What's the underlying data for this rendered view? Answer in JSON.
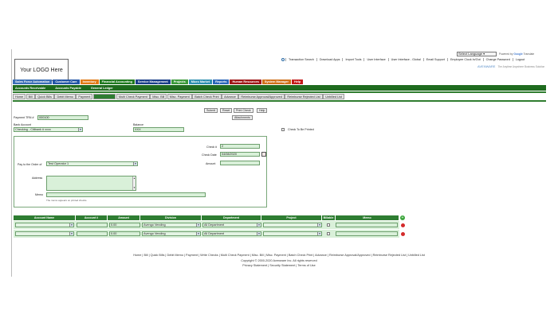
{
  "translate": {
    "select_label": "Select Language",
    "powered_by": "Powered by",
    "google": "Google",
    "translate_word": "Translate"
  },
  "logo_text": "Your LOGO Here",
  "top_links": [
    "Transaction Search",
    "Download Apps",
    "Import Tools",
    "User Interface",
    "User Interface - Global",
    "Email Support",
    "Employee Clock In/Out",
    "Change Password",
    "Logout"
  ],
  "brand": {
    "name": "AVENWARE",
    "tagline": "The Anytime Anywhere Business Solution"
  },
  "main_nav": [
    {
      "label": "Sales Force Automation",
      "color": "#3b6fb6"
    },
    {
      "label": "Customer Care",
      "color": "#2456a6"
    },
    {
      "label": "Inventory",
      "color": "#e07a16"
    },
    {
      "label": "Financial Accounting",
      "color": "#1f7a1f"
    },
    {
      "label": "Service Management",
      "color": "#1a3f8a"
    },
    {
      "label": "Projects",
      "color": "#3a9a3a"
    },
    {
      "label": "Micro Market",
      "color": "#2e8fb0"
    },
    {
      "label": "Reports",
      "color": "#2a66b8"
    },
    {
      "label": "Human Resources",
      "color": "#a01818"
    },
    {
      "label": "System Manager",
      "color": "#d0701a"
    },
    {
      "label": "Help",
      "color": "#c41a1a"
    }
  ],
  "sub_nav": [
    "Accounts Receivable",
    "Accounts Payable",
    "General Ledger"
  ],
  "sub_tabs": [
    "Home",
    "Bill",
    "Quick Bills",
    "Debit Memo",
    "Payment",
    "Write Checks",
    "Multi Check Payment",
    "Misc. Bill",
    "Misc. Payment",
    "Batch Check Print",
    "Advance",
    "Reimburse Approval/Approved",
    "Reimburse Rejected List",
    "Unbilled List"
  ],
  "active_sub_tab": 5,
  "actions": {
    "submit": "Submit",
    "reset": "Reset",
    "print_check": "Print Check",
    "help": "Help",
    "attachments": "Attachments"
  },
  "form": {
    "payment_trn_label": "Payment TRN #",
    "payment_trn_value": "000100",
    "bank_account_label": "Bank Account",
    "bank_account_value": "Checking - Citibank # xxxx",
    "balance_label": "Balance",
    "balance_value": "XXX",
    "check_to_be_printed_label": "Check To Be Printed",
    "check_no_label": "Check #",
    "check_no_value": "2",
    "check_date_label": "Check Date",
    "check_date_value": "04/08/2020",
    "amount_label": "Amount",
    "amount_value": "",
    "pay_to_label": "Pay to the Order of",
    "pay_to_value": "Test Operator 1",
    "address_label": "Address",
    "memo_label": "Memo",
    "memo_note": "The memo appears on printed checks."
  },
  "table": {
    "headers": [
      "Account Name",
      "Account #",
      "Amount",
      "Division",
      "Department",
      "Project",
      "Billable",
      "Memo"
    ],
    "rows": [
      {
        "amount": "0.00",
        "division": "Avengo Vending",
        "department": "All Department"
      },
      {
        "amount": "0.00",
        "division": "Avengo Vending",
        "department": "All Department"
      }
    ]
  },
  "footer": {
    "links": [
      "Home",
      "Bill",
      "Quick Bills",
      "Debit Memo",
      "Payment",
      "Write Checks",
      "Multi Check Payment",
      "Misc. Bill",
      "Misc. Payment",
      "Batch Check Print",
      "Advance",
      "Reimburse Approval/Approved",
      "Reimburse Rejected List",
      "Unbilled List"
    ],
    "copyright": "Copyright © 2000-2020 Avenware Inc. All rights reserved",
    "legal": [
      "Privacy Statement",
      "Security Statement",
      "Terms of Use"
    ]
  },
  "colors": {
    "accent_green": "#2e7d32",
    "field_green": "#d9f0d9"
  }
}
